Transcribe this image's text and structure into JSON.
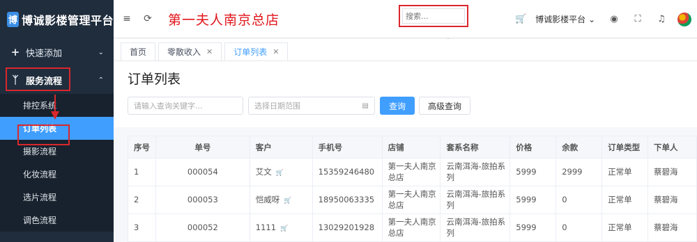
{
  "sidebar": {
    "logo_mark": "博",
    "logo_text": "博诚影楼管理平台",
    "quick_add": {
      "icon": "+",
      "label": "快速添加"
    },
    "service_flow": {
      "label": "服务流程"
    },
    "sub_items": [
      "排控系统",
      "订单列表",
      "摄影流程",
      "化妆流程",
      "选片流程",
      "调色流程"
    ]
  },
  "header": {
    "store_name": "第一夫人南京总店",
    "search_placeholder": "搜索...",
    "platform_label": "博诚影楼平台"
  },
  "tabs": [
    {
      "label": "首页",
      "closable": false
    },
    {
      "label": "零散收入",
      "closable": true
    },
    {
      "label": "订单列表",
      "closable": true
    }
  ],
  "page": {
    "title": "订单列表",
    "keyword_placeholder": "请输入查询关键字...",
    "date_placeholder": "选择日期范围",
    "query_label": "查询",
    "advanced_label": "高级查询"
  },
  "table": {
    "headers": [
      "序号",
      "单号",
      "客户",
      "手机号",
      "店铺",
      "套系名称",
      "价格",
      "余款",
      "订单类型",
      "下单人"
    ],
    "rows": [
      [
        "1",
        "000054",
        "艾文",
        "15359246480",
        "第一夫人南京总店",
        "云南洱海-旅拍系列",
        "5999",
        "2999",
        "正常单",
        "蔡碧海"
      ],
      [
        "2",
        "000053",
        "恺威呀",
        "18950063335",
        "第一夫人南京总店",
        "云南洱海-旅拍系列",
        "5999",
        "0",
        "正常单",
        "蔡碧海"
      ],
      [
        "3",
        "000052",
        "1111",
        "13029201928",
        "第一夫人南京总店",
        "云南洱海-旅拍系列",
        "5999",
        "0",
        "正常单",
        "蔡碧海"
      ]
    ]
  },
  "colors": {
    "sidebar_bg": "#1f2d3d",
    "accent": "#409eff",
    "annotation": "#d9272d"
  }
}
